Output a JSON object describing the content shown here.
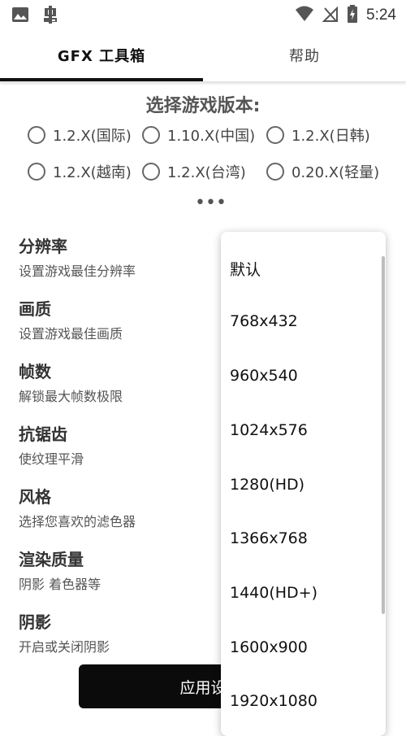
{
  "status_bar": {
    "time": "5:24",
    "icons": [
      "image-icon",
      "bug-icon",
      "wifi-icon",
      "no-signal-icon",
      "battery-charging-icon"
    ]
  },
  "tabs": [
    {
      "label": "GFX 工具箱",
      "selected": true
    },
    {
      "label": "帮助",
      "selected": false
    }
  ],
  "version": {
    "title": "选择游戏版本:",
    "options": [
      "1.2.X(国际)",
      "1.10.X(中国)",
      "1.2.X(日韩)",
      "1.2.X(越南)",
      "1.2.X(台湾)",
      "0.20.X(轻量)"
    ]
  },
  "settings": [
    {
      "title": "分辨率",
      "desc": "设置游戏最佳分辨率"
    },
    {
      "title": "画质",
      "desc": "设置游戏最佳画质"
    },
    {
      "title": "帧数",
      "desc": "解锁最大帧数极限"
    },
    {
      "title": "抗锯齿",
      "desc": "使纹理平滑"
    },
    {
      "title": "风格",
      "desc": "选择您喜欢的滤色器"
    },
    {
      "title": "渲染质量",
      "desc": "阴影 着色器等"
    },
    {
      "title": "阴影",
      "desc": "开启或关闭阴影"
    }
  ],
  "apply_button": "应用设",
  "resolution_menu": {
    "options": [
      "默认",
      "768x432",
      "960x540",
      "1024x576",
      "1280(HD)",
      "1366x768",
      "1440(HD+)",
      "1600x900",
      "1920x1080"
    ]
  }
}
